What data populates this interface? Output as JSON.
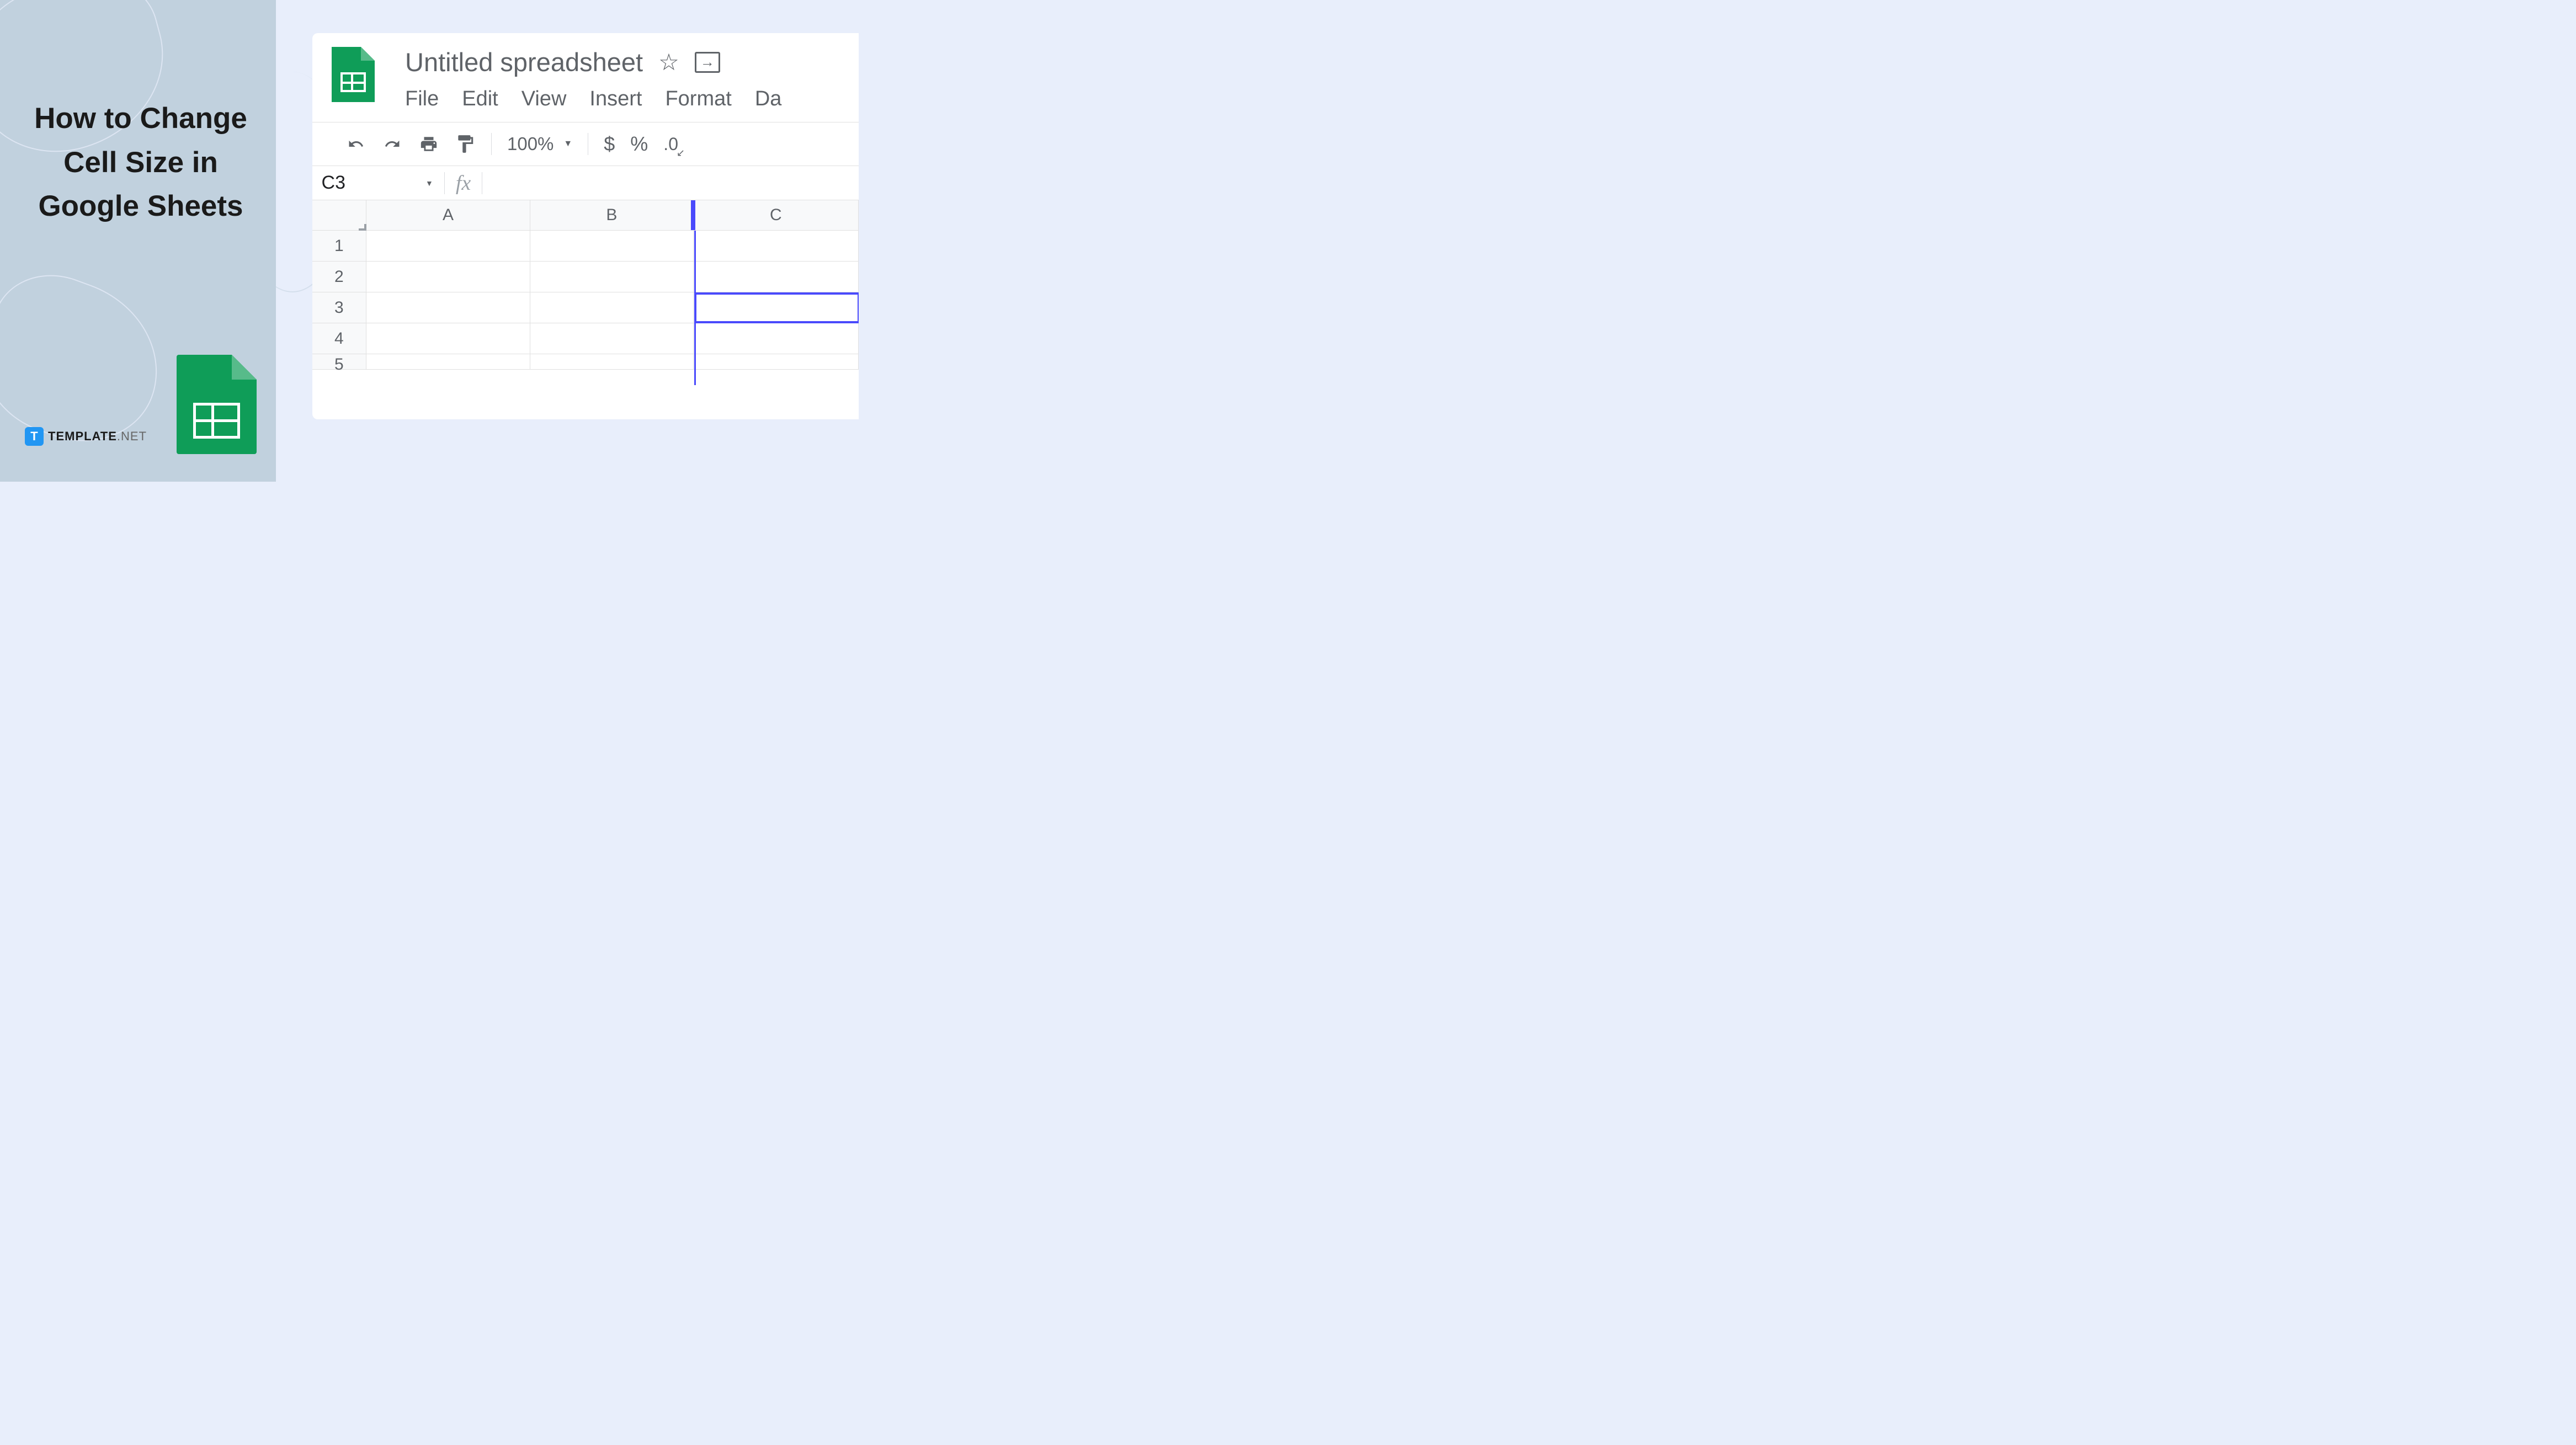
{
  "left": {
    "title": "How to Change Cell Size in Google Sheets",
    "brand": {
      "letter": "T",
      "name": "TEMPLATE",
      "suffix": ".NET"
    }
  },
  "app": {
    "doc_title": "Untitled spreadsheet",
    "menu": {
      "file": "File",
      "edit": "Edit",
      "view": "View",
      "insert": "Insert",
      "format": "Format",
      "data": "Da"
    },
    "toolbar": {
      "zoom": "100%",
      "currency": "$",
      "percent": "%",
      "decimal": ".0"
    },
    "name_box": "C3",
    "fx": "fx",
    "columns": [
      "A",
      "B",
      "C"
    ],
    "rows": [
      "1",
      "2",
      "3",
      "4",
      "5"
    ]
  }
}
